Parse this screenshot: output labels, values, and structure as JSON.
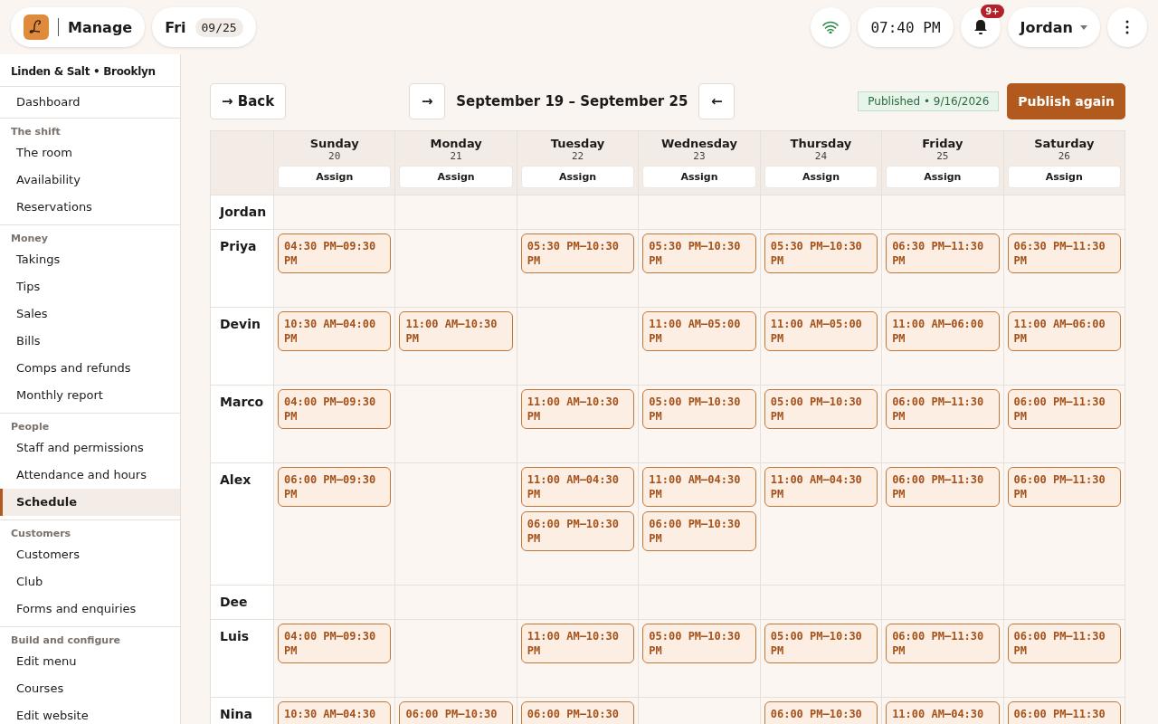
{
  "topbar": {
    "app_label": "Manage",
    "day": "Fri",
    "date": "09/25",
    "time": "07:40 PM",
    "notification_badge": "9+",
    "user": "Jordan"
  },
  "sidebar": {
    "venue": "Linden & Salt • Brooklyn",
    "groups": [
      {
        "items": [
          {
            "label": "Dashboard",
            "selected": false
          }
        ]
      },
      {
        "heading": "The shift",
        "items": [
          {
            "label": "The room",
            "selected": false
          },
          {
            "label": "Availability",
            "selected": false
          },
          {
            "label": "Reservations",
            "selected": false
          }
        ]
      },
      {
        "heading": "Money",
        "items": [
          {
            "label": "Takings",
            "selected": false
          },
          {
            "label": "Tips",
            "selected": false
          },
          {
            "label": "Sales",
            "selected": false
          },
          {
            "label": "Bills",
            "selected": false
          },
          {
            "label": "Comps and refunds",
            "selected": false
          },
          {
            "label": "Monthly report",
            "selected": false
          }
        ]
      },
      {
        "heading": "People",
        "items": [
          {
            "label": "Staff and permissions",
            "selected": false
          },
          {
            "label": "Attendance and hours",
            "selected": false
          },
          {
            "label": "Schedule",
            "selected": true
          }
        ]
      },
      {
        "heading": "Customers",
        "items": [
          {
            "label": "Customers",
            "selected": false
          },
          {
            "label": "Club",
            "selected": false
          },
          {
            "label": "Forms and enquiries",
            "selected": false
          }
        ]
      },
      {
        "heading": "Build and configure",
        "items": [
          {
            "label": "Edit menu",
            "selected": false
          },
          {
            "label": "Courses",
            "selected": false
          },
          {
            "label": "Edit website",
            "selected": false
          }
        ]
      }
    ]
  },
  "toolbar": {
    "back": "→ Back",
    "next": "→",
    "range": "September 19 – September 25",
    "prev": "←",
    "status": "Published • 9/16/2026",
    "publish": "Publish again"
  },
  "schedule": {
    "days": [
      {
        "name": "Sunday",
        "date": "20",
        "action": "Assign"
      },
      {
        "name": "Monday",
        "date": "21",
        "action": "Assign"
      },
      {
        "name": "Tuesday",
        "date": "22",
        "action": "Assign"
      },
      {
        "name": "Wednesday",
        "date": "23",
        "action": "Assign"
      },
      {
        "name": "Thursday",
        "date": "24",
        "action": "Assign"
      },
      {
        "name": "Friday",
        "date": "25",
        "action": "Assign"
      },
      {
        "name": "Saturday",
        "date": "26",
        "action": "Assign"
      }
    ],
    "rows": [
      {
        "name": "Jordan",
        "cells": [
          [],
          [],
          [],
          [],
          [],
          [],
          []
        ]
      },
      {
        "name": "Priya",
        "cells": [
          [
            "04:30 PM–09:30 PM"
          ],
          [],
          [
            "05:30 PM–10:30 PM"
          ],
          [
            "05:30 PM–10:30 PM"
          ],
          [
            "05:30 PM–10:30 PM"
          ],
          [
            "06:30 PM–11:30 PM"
          ],
          [
            "06:30 PM–11:30 PM"
          ]
        ]
      },
      {
        "name": "Devin",
        "cells": [
          [
            "10:30 AM–04:00 PM"
          ],
          [
            "11:00 AM–10:30 PM"
          ],
          [],
          [
            "11:00 AM–05:00 PM"
          ],
          [
            "11:00 AM–05:00 PM"
          ],
          [
            "11:00 AM–06:00 PM"
          ],
          [
            "11:00 AM–06:00 PM"
          ]
        ]
      },
      {
        "name": "Marco",
        "cells": [
          [
            "04:00 PM–09:30 PM"
          ],
          [],
          [
            "11:00 AM–10:30 PM"
          ],
          [
            "05:00 PM–10:30 PM"
          ],
          [
            "05:00 PM–10:30 PM"
          ],
          [
            "06:00 PM–11:30 PM"
          ],
          [
            "06:00 PM–11:30 PM"
          ]
        ]
      },
      {
        "name": "Alex",
        "cells": [
          [
            "06:00 PM–09:30 PM"
          ],
          [],
          [
            "11:00 AM–04:30 PM",
            "06:00 PM–10:30 PM"
          ],
          [
            "11:00 AM–04:30 PM",
            "06:00 PM–10:30 PM"
          ],
          [
            "11:00 AM–04:30 PM"
          ],
          [
            "06:00 PM–11:30 PM"
          ],
          [
            "06:00 PM–11:30 PM"
          ]
        ]
      },
      {
        "name": "Dee",
        "cells": [
          [],
          [],
          [],
          [],
          [],
          [],
          []
        ]
      },
      {
        "name": "Luis",
        "cells": [
          [
            "04:00 PM–09:30 PM"
          ],
          [],
          [
            "11:00 AM–10:30 PM"
          ],
          [
            "05:00 PM–10:30 PM"
          ],
          [
            "05:00 PM–10:30 PM"
          ],
          [
            "06:00 PM–11:30 PM"
          ],
          [
            "06:00 PM–11:30 PM"
          ]
        ]
      },
      {
        "name": "Nina",
        "cells": [
          [
            "10:30 AM–04:30"
          ],
          [
            "06:00 PM–10:30"
          ],
          [
            "06:00 PM–10:30"
          ],
          [],
          [
            "06:00 PM–10:30"
          ],
          [
            "11:00 AM–04:30"
          ],
          [
            "06:00 PM–11:30"
          ]
        ]
      }
    ]
  }
}
